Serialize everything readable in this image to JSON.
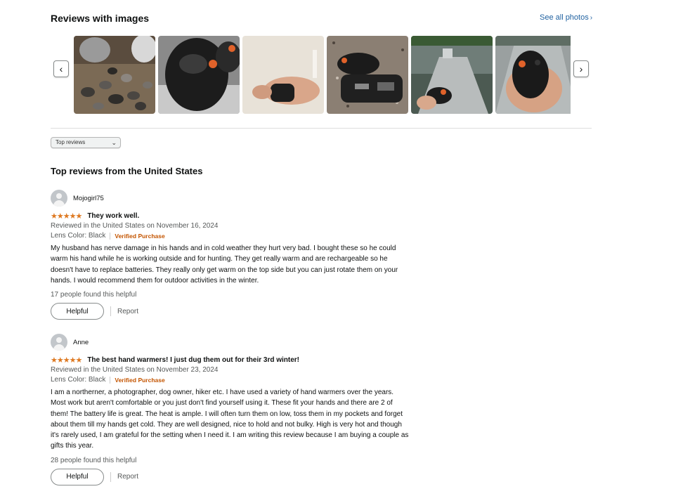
{
  "images_section": {
    "title": "Reviews with images",
    "see_all": "See all photos",
    "see_all_chevron": "›",
    "prev_arrow": "‹",
    "next_arrow": "›"
  },
  "sort": {
    "selected": "Top reviews",
    "caret": "⌄"
  },
  "reviews_heading": "Top reviews from the United States",
  "reviews": [
    {
      "name": "Mojogirl75",
      "stars": "★★★★★",
      "title": "They work well.",
      "date": "Reviewed in the United States on November 16, 2024",
      "lens": "Lens Color: Black",
      "verified": "Verified Purchase",
      "body": "My husband has nerve damage in his hands and in cold weather they hurt very bad. I bought these so he could warm his hand while he is working outside and for hunting. They get really warm and are rechargeable so he doesn't have to replace batteries. They really only get warm on the top side but you can just rotate them on your hands. I would recommend them for outdoor activities in the winter.",
      "helpful_count": "17 people found this helpful",
      "helpful_label": "Helpful",
      "report_label": "Report"
    },
    {
      "name": "Anne",
      "stars": "★★★★★",
      "title": "The best hand warmers! I just dug them out for their 3rd winter!",
      "date": "Reviewed in the United States on November 23, 2024",
      "lens": "Lens Color: Black",
      "verified": "Verified Purchase",
      "body": "I am a northerner, a photographer, dog owner, hiker etc. I have used a variety of hand warmers over the years. Most work but aren't comfortable or you just don't find yourself using it. These fit your hands and there are 2 of them! The battery life is great. The heat is ample. I will often turn them on low, toss them in my pockets and forget about them till my hands get cold. They are well designed, nice to hold and not bulky. High is very hot and though it's rarely used, I am grateful for the setting when I need it. I am writing this review because I am buying a couple as gifts this year.",
      "helpful_count": "28 people found this helpful",
      "helpful_label": "Helpful",
      "report_label": "Report"
    }
  ]
}
